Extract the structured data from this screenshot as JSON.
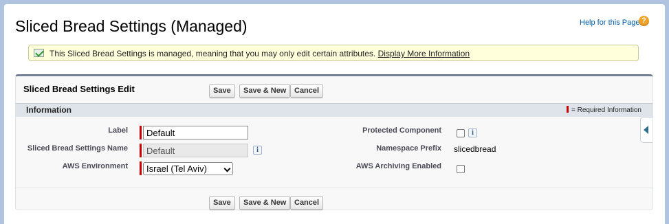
{
  "page": {
    "title": "Sliced Bread Settings (Managed)",
    "help_link": "Help for this Page",
    "help_icon": "question-icon"
  },
  "banner": {
    "icon": "managed-package-icon",
    "text": "This Sliced Bread Settings is managed, meaning that you may only edit certain attributes.",
    "link": "Display More Information"
  },
  "panel": {
    "title": "Sliced Bread Settings Edit",
    "buttons": {
      "save": "Save",
      "save_new": "Save & New",
      "cancel": "Cancel"
    },
    "section": {
      "title": "Information",
      "required_note": "= Required Information"
    },
    "fields": {
      "label": {
        "label": "Label",
        "value": "Default"
      },
      "settings_name": {
        "label": "Sliced Bread Settings Name",
        "value": "Default"
      },
      "aws_environment": {
        "label": "AWS Environment",
        "value": "Israel (Tel Aviv)"
      },
      "protected_component": {
        "label": "Protected Component",
        "checked": false
      },
      "namespace_prefix": {
        "label": "Namespace Prefix",
        "value": "slicedbread"
      },
      "aws_archiving": {
        "label": "AWS Archiving Enabled",
        "checked": false
      }
    }
  },
  "colors": {
    "background": "#b0c4df",
    "banner": "#ffffdc",
    "panel_border": "#747e96",
    "section_header": "#dfe3ea",
    "required": "#cc0000",
    "link": "#015ba7"
  }
}
